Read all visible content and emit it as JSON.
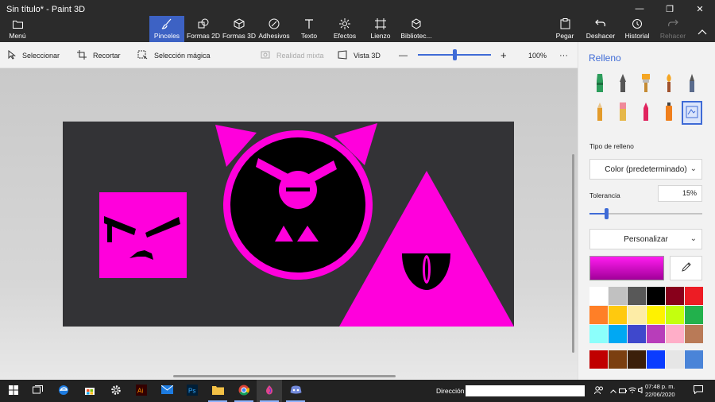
{
  "app": {
    "title": "Sin título* - Paint 3D",
    "window_controls": [
      "—",
      "❐",
      "✕"
    ]
  },
  "ribbon": {
    "menu_label": "Menú",
    "tabs": [
      {
        "label": "Pinceles",
        "icon": "brush-icon",
        "active": true
      },
      {
        "label": "Formas 2D",
        "icon": "shapes-2d-icon"
      },
      {
        "label": "Formas 3D",
        "icon": "cube-icon"
      },
      {
        "label": "Adhesivos",
        "icon": "sticker-icon"
      },
      {
        "label": "Texto",
        "icon": "text-icon"
      },
      {
        "label": "Efectos",
        "icon": "effects-icon"
      },
      {
        "label": "Lienzo",
        "icon": "canvas-icon"
      },
      {
        "label": "Bibliotec...",
        "icon": "library-icon"
      }
    ],
    "right_actions": [
      {
        "label": "Pegar",
        "icon": "paste-icon"
      },
      {
        "label": "Deshacer",
        "icon": "undo-icon"
      },
      {
        "label": "Historial",
        "icon": "history-icon"
      },
      {
        "label": "Rehacer",
        "icon": "redo-icon",
        "disabled": true
      }
    ]
  },
  "toolbar": {
    "select_label": "Seleccionar",
    "crop_label": "Recortar",
    "magic_select_label": "Selección mágica",
    "mixed_reality_label": "Realidad mixta",
    "view3d_label": "Vista 3D",
    "zoom_minus": "—",
    "zoom_plus": "+",
    "zoom_value": "100%",
    "zoom_fraction": 0.5,
    "more": "···"
  },
  "panel": {
    "title": "Relleno",
    "brushes": [
      "marker",
      "calligraphy-pen",
      "oil-brush",
      "watercolor",
      "pixel-pen",
      "pencil",
      "eraser",
      "crayon",
      "spray-can",
      "fill"
    ],
    "selected_brush": "fill",
    "fill_type_label": "Tipo de relleno",
    "fill_type_value": "Color (predeterminado)",
    "tolerance_label": "Tolerancia",
    "tolerance_value": "15%",
    "tolerance_fraction": 0.15,
    "customize_label": "Personalizar",
    "current_color": "#ff00ee",
    "palette": [
      "#ffffff",
      "#c1c1c1",
      "#585858",
      "#000000",
      "#88001b",
      "#ed1c24",
      "#ff7f27",
      "#ffc90e",
      "#fdeca6",
      "#fff200",
      "#c4ff0e",
      "#22b14c",
      "#8cfffb",
      "#00a8f3",
      "#3f48cc",
      "#b83dba",
      "#ffaec8",
      "#b97a57",
      "#c00000",
      "#7b3f10",
      "#3b1f0a",
      "#0a3cff",
      "#e6e6e6",
      "#4a84d8"
    ]
  },
  "canvas_art": {
    "background": "#333336",
    "shape_color": "#ff00dc",
    "face_color": "#000000"
  },
  "taskbar": {
    "apps": [
      "windows-start-icon",
      "task-view-icon",
      "edge-icon",
      "store-icon",
      "settings-icon",
      "illustrator-icon",
      "mail-icon",
      "photoshop-icon",
      "file-explorer-icon",
      "chrome-icon",
      "paint3d-icon",
      "discord-icon"
    ],
    "address_label": "Dirección",
    "time": "07:48 p. m.",
    "date": "22/06/2020"
  }
}
